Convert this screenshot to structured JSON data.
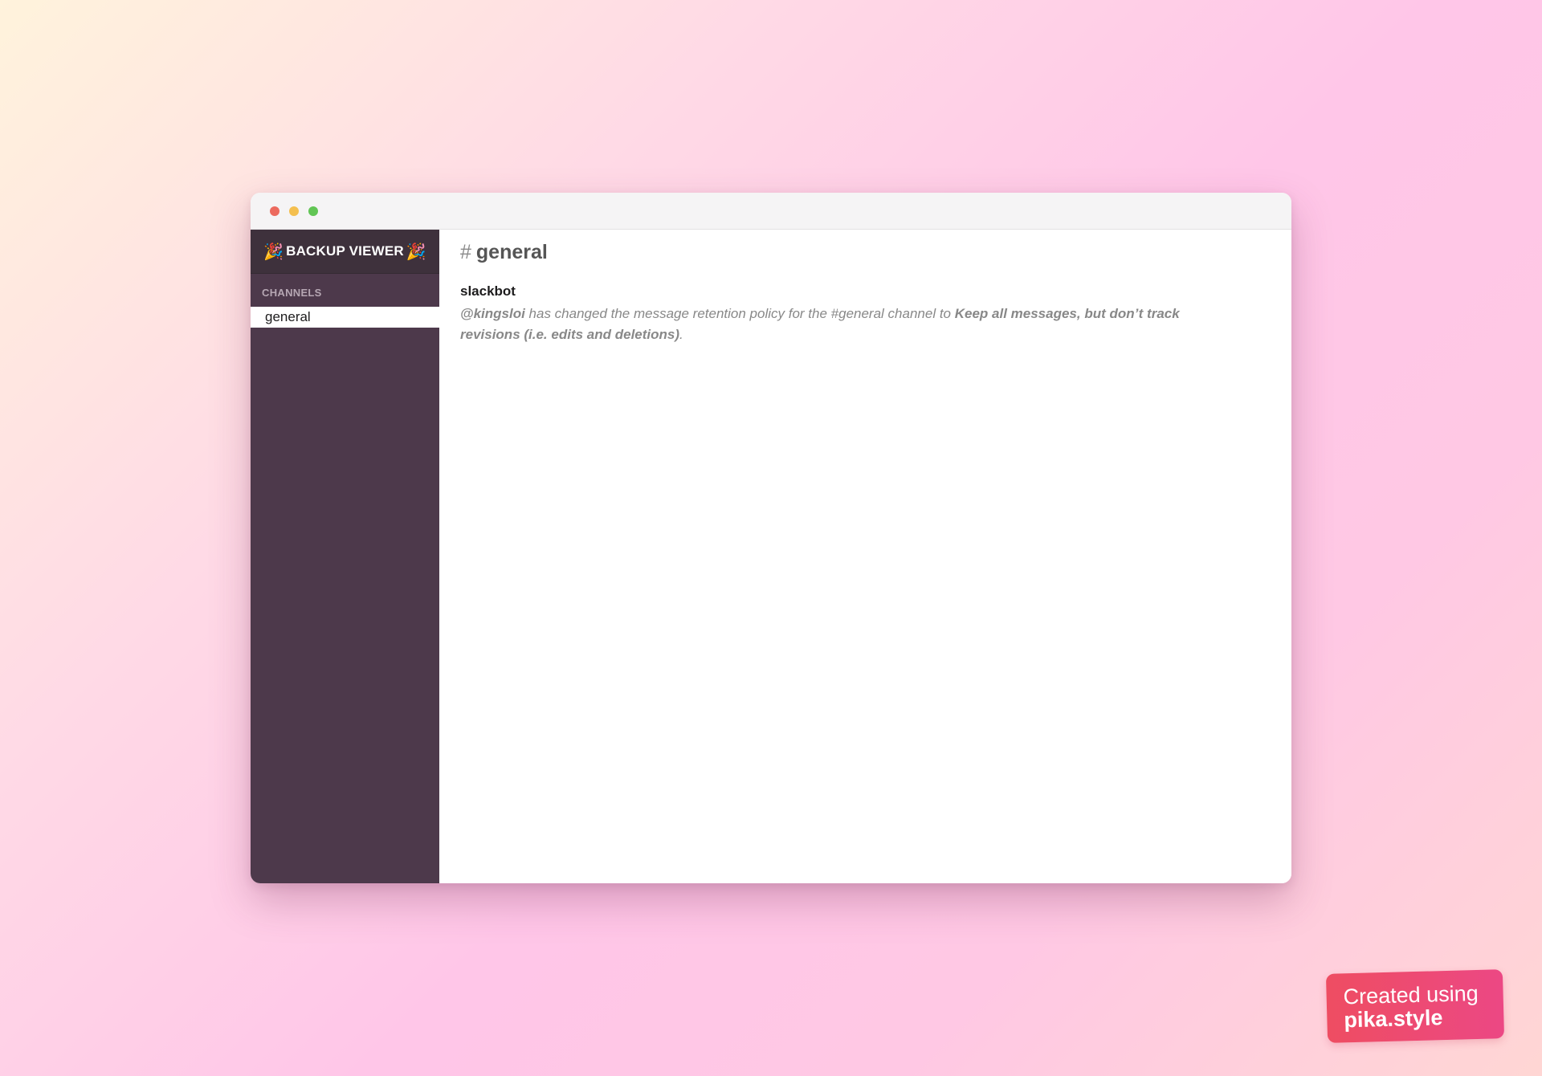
{
  "window": {
    "controls": [
      "close",
      "minimize",
      "maximize"
    ]
  },
  "sidebar": {
    "app_title": "BACKUP VIEWER",
    "title_emoji": "🎉",
    "section_label": "CHANNELS",
    "channels": [
      {
        "label": "general",
        "selected": true
      }
    ]
  },
  "main": {
    "channel_hash": "#",
    "channel_name": "general",
    "messages": [
      {
        "author": "slackbot",
        "mention": "@kingsloi",
        "text_middle": " has changed the message retention policy for the #general channel to ",
        "policy": "Keep all messages, but don’t track revisions (i.e. edits and deletions)",
        "text_end": "."
      }
    ]
  },
  "watermark": {
    "line1": "Created using",
    "line2": "pika.style"
  },
  "colors": {
    "sidebar_bg": "#4d394b",
    "sidebar_header_bg": "#3e313c",
    "selected_channel_bg": "#ffffff",
    "badge_gradient_start": "#ee4d62",
    "badge_gradient_end": "#ec4884"
  }
}
